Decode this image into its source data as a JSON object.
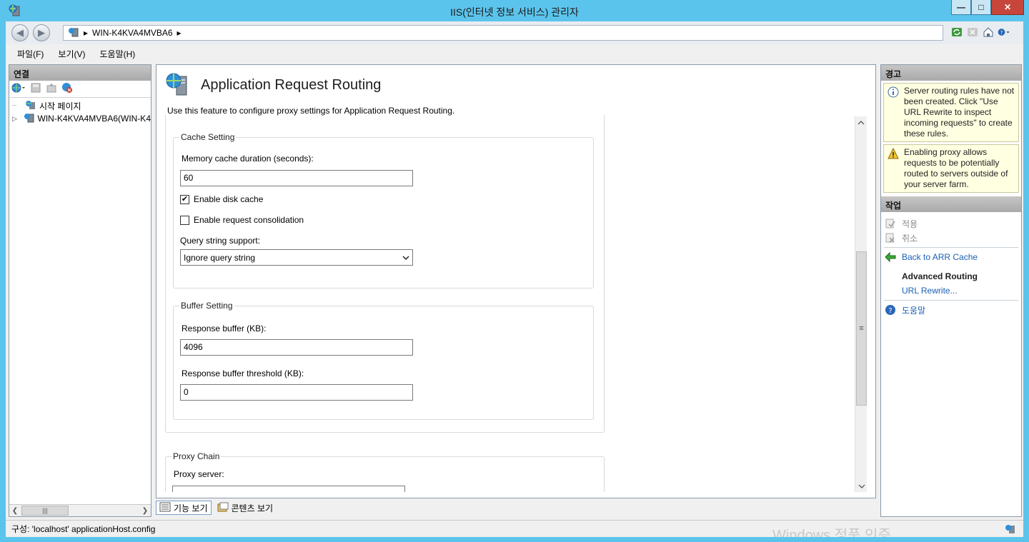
{
  "window": {
    "title": "IIS(인터넷 정보 서비스) 관리자",
    "controls": {
      "minimize": "—",
      "maximize": "□",
      "close": "✕"
    }
  },
  "address": {
    "crumb": "WIN-K4KVA4MVBA6",
    "separator": "▸"
  },
  "menu": {
    "file": "파일(F)",
    "view": "보기(V)",
    "help": "도움말(H)"
  },
  "left_panel": {
    "header": "연결",
    "tree": [
      {
        "label": "시작 페이지"
      },
      {
        "label": "WIN-K4KVA4MVBA6(WIN-K4"
      }
    ]
  },
  "feature": {
    "title": "Application Request Routing",
    "description": "Use this feature to configure proxy settings for Application Request Routing."
  },
  "cache_setting": {
    "title": "Cache Setting",
    "memory_label": "Memory cache duration (seconds):",
    "memory_value": "60",
    "disk_cache_label": "Enable disk cache",
    "disk_cache_checked": true,
    "consolidation_label": "Enable request consolidation",
    "consolidation_checked": false,
    "query_label": "Query string support:",
    "query_value": "Ignore query string"
  },
  "buffer_setting": {
    "title": "Buffer Setting",
    "response_buffer_label": "Response buffer (KB):",
    "response_buffer_value": "4096",
    "threshold_label": "Response buffer threshold (KB):",
    "threshold_value": "0"
  },
  "proxy_chain": {
    "title": "Proxy Chain",
    "server_label": "Proxy server:"
  },
  "view_tabs": {
    "features": "기능 보기",
    "content": "콘텐츠 보기"
  },
  "right_panel": {
    "alerts_header": "경고",
    "alerts": [
      {
        "type": "info",
        "text": "Server routing rules have not been created. Click \"Use URL Rewrite to inspect incoming requests\" to create these rules."
      },
      {
        "type": "warning",
        "text": "Enabling proxy allows requests to be potentially routed to servers outside of your server farm."
      }
    ],
    "actions_header": "작업",
    "apply": "적용",
    "cancel": "취소",
    "back": "Back to ARR Cache",
    "advanced_routing": "Advanced Routing",
    "url_rewrite": "URL Rewrite...",
    "help": "도움말"
  },
  "status": {
    "config": "구성: 'localhost' applicationHost.config",
    "watermark": "Windows 정품 인증"
  },
  "colors": {
    "titlebar": "#5bc4ec",
    "link": "#1a5fb4",
    "alert_bg": "#ffffe1"
  }
}
